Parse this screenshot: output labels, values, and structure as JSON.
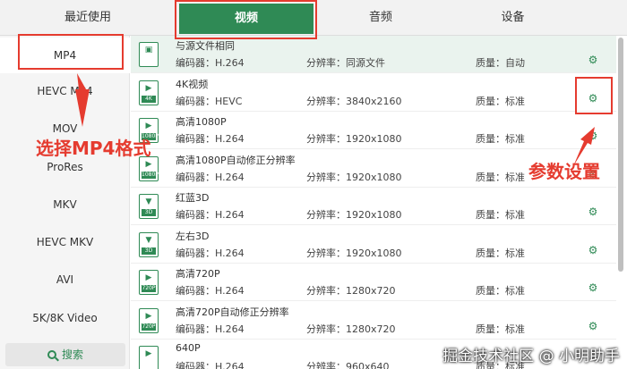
{
  "tabs": [
    "最近使用",
    "视频",
    "音频",
    "设备"
  ],
  "sidebar": {
    "items": [
      "MP4",
      "HEVC MP4",
      "MOV",
      "ProRes",
      "MKV",
      "HEVC MKV",
      "AVI",
      "5K/8K Video"
    ],
    "active_index": 0,
    "search_label": "搜索"
  },
  "rows": [
    {
      "name": "与源文件相同",
      "codec": "编码器：H.264",
      "res": "分辨率：同源文件",
      "quality": "质量：自动",
      "tag": ""
    },
    {
      "name": "4K视频",
      "codec": "编码器：HEVC",
      "res": "分辨率：3840x2160",
      "quality": "质量：标准",
      "tag": "4K"
    },
    {
      "name": "高清1080P",
      "codec": "编码器：H.264",
      "res": "分辨率：1920x1080",
      "quality": "质量：标准",
      "tag": "1080P"
    },
    {
      "name": "高清1080P自动修正分辨率",
      "codec": "编码器：H.264",
      "res": "分辨率：1920x1080",
      "quality": "质量：标准",
      "tag": "1080P"
    },
    {
      "name": "红蓝3D",
      "codec": "编码器：H.264",
      "res": "分辨率：1920x1080",
      "quality": "质量：标准",
      "tag": "3D"
    },
    {
      "name": "左右3D",
      "codec": "编码器：H.264",
      "res": "分辨率：1920x1080",
      "quality": "质量：标准",
      "tag": "3D"
    },
    {
      "name": "高清720P",
      "codec": "编码器：H.264",
      "res": "分辨率：1280x720",
      "quality": "质量：标准",
      "tag": "720P"
    },
    {
      "name": "高清720P自动修正分辨率",
      "codec": "编码器：H.264",
      "res": "分辨率：1280x720",
      "quality": "质量：标准",
      "tag": "720P"
    },
    {
      "name": "640P",
      "codec": "编码器：H.264",
      "res": "分辨率：960x640",
      "quality": "质量：标准",
      "tag": ""
    }
  ],
  "annotations": {
    "select_mp4": "选择MP4格式",
    "params": "参数设置"
  },
  "watermark": "掘金技术社区 @ 小明助手",
  "colors": {
    "accent": "#2f8a55",
    "annotation": "#e53b2f"
  },
  "icons": {
    "gear": "gear-icon",
    "search": "search-icon",
    "file": "video-file-icon"
  }
}
